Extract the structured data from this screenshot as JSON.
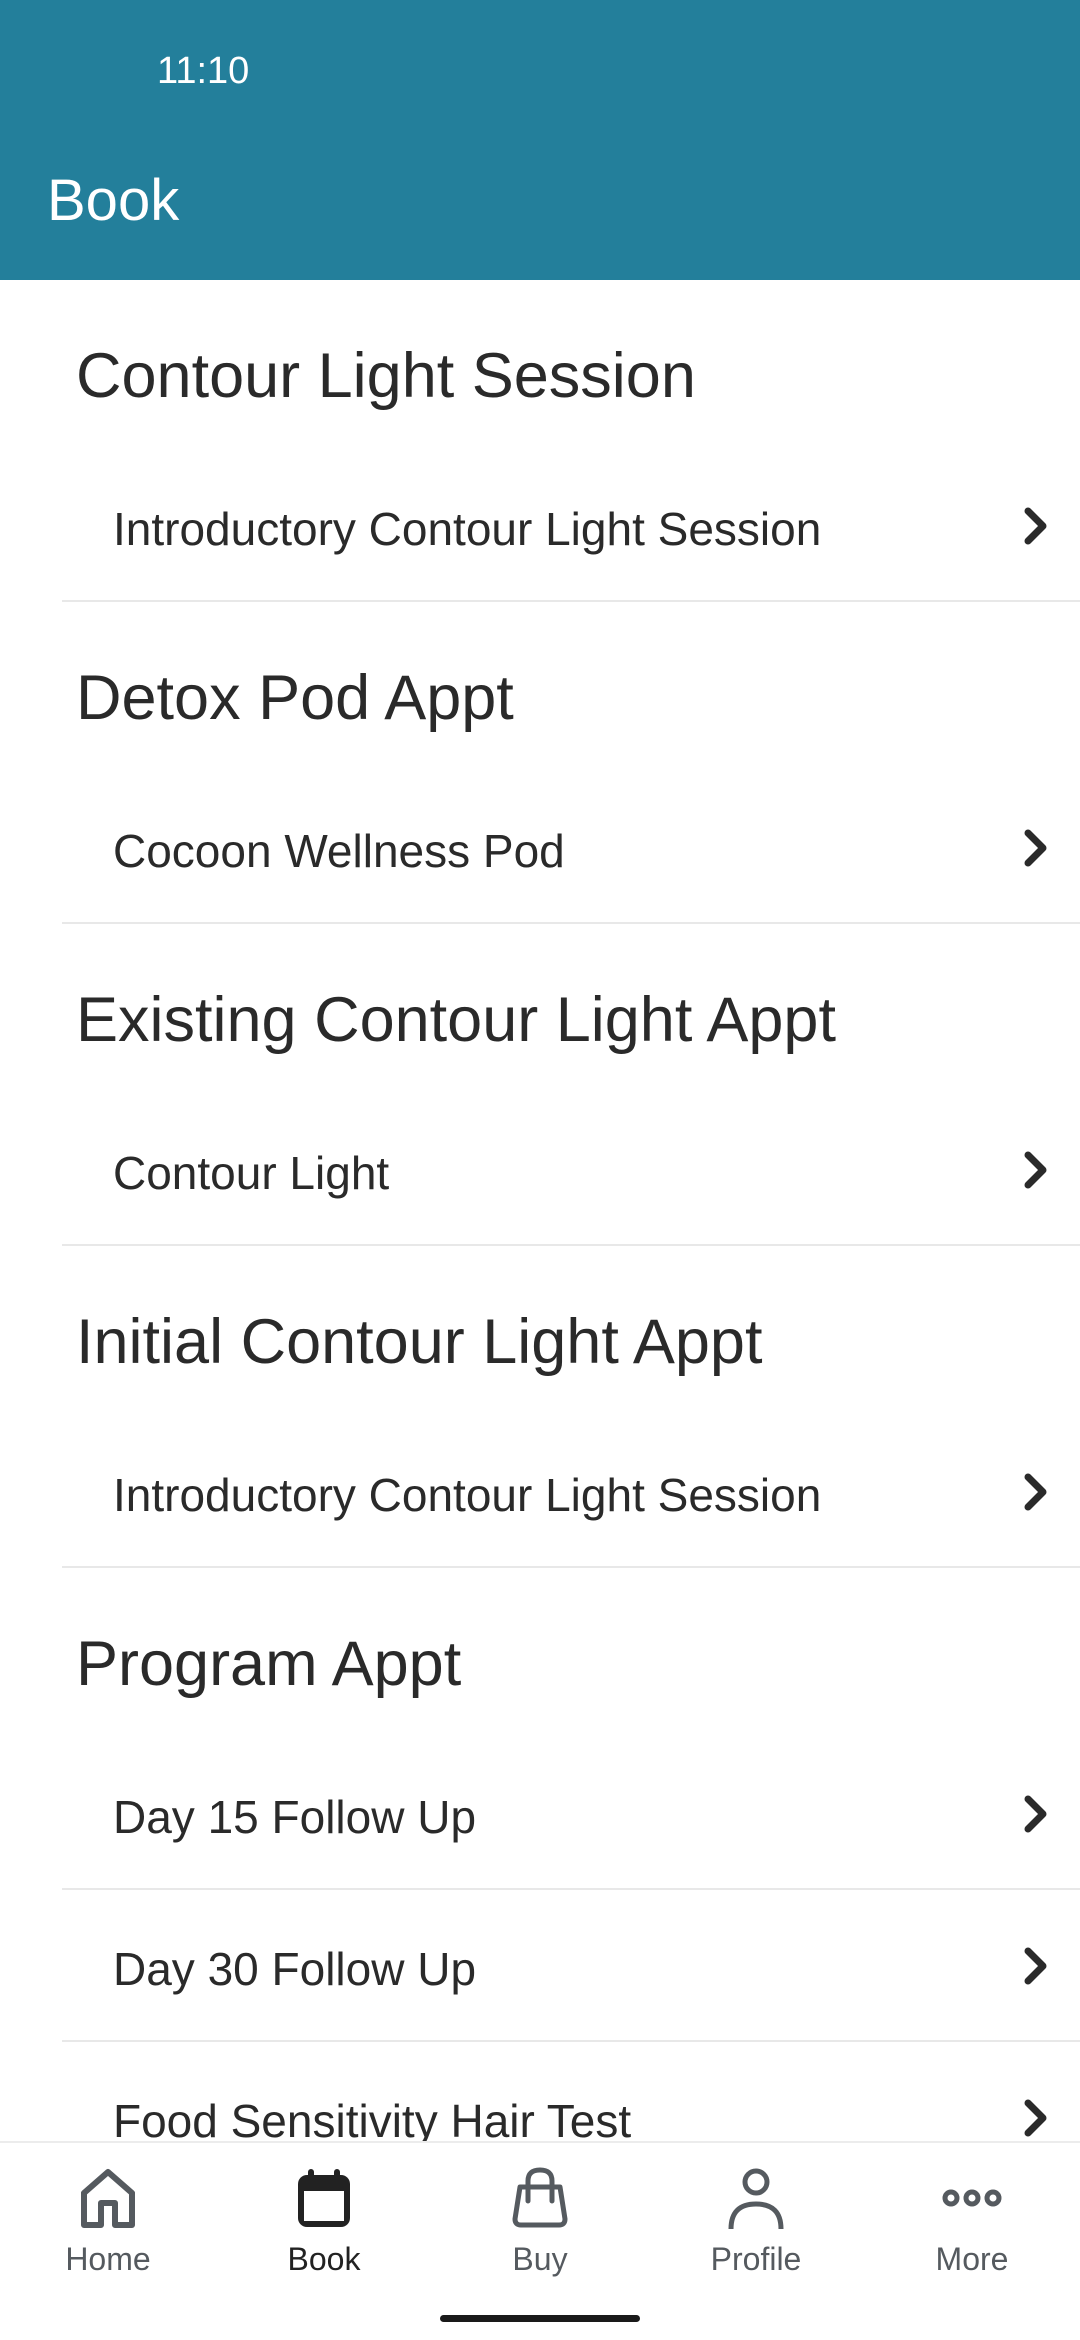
{
  "status_bar": {
    "time": "11:10"
  },
  "header": {
    "title": "Book"
  },
  "colors": {
    "header_bg": "#237f9b",
    "text": "#2a2a2a",
    "nav_inactive": "#555a5f",
    "nav_active": "#222222"
  },
  "sections": [
    {
      "heading": "Contour Light Session",
      "items": [
        {
          "label": "Introductory Contour Light Session",
          "icon": "chevron-right-icon"
        }
      ]
    },
    {
      "heading": "Detox Pod Appt",
      "items": [
        {
          "label": "Cocoon Wellness Pod",
          "icon": "chevron-right-icon"
        }
      ]
    },
    {
      "heading": "Existing Contour Light Appt",
      "items": [
        {
          "label": "Contour Light",
          "icon": "chevron-right-icon"
        }
      ]
    },
    {
      "heading": "Initial Contour Light Appt",
      "items": [
        {
          "label": "Introductory Contour Light Session",
          "icon": "chevron-right-icon"
        }
      ]
    },
    {
      "heading": "Program Appt",
      "items": [
        {
          "label": "Day 15 Follow Up",
          "icon": "chevron-right-icon"
        },
        {
          "label": "Day 30 Follow Up",
          "icon": "chevron-right-icon"
        },
        {
          "label": "Food Sensitivity Hair Test",
          "icon": "chevron-right-icon"
        }
      ]
    }
  ],
  "bottom_nav": {
    "active": "Book",
    "items": [
      {
        "label": "Home",
        "icon": "home-icon"
      },
      {
        "label": "Book",
        "icon": "calendar-icon"
      },
      {
        "label": "Buy",
        "icon": "shopping-bag-icon"
      },
      {
        "label": "Profile",
        "icon": "person-icon"
      },
      {
        "label": "More",
        "icon": "more-horizontal-icon"
      }
    ]
  }
}
